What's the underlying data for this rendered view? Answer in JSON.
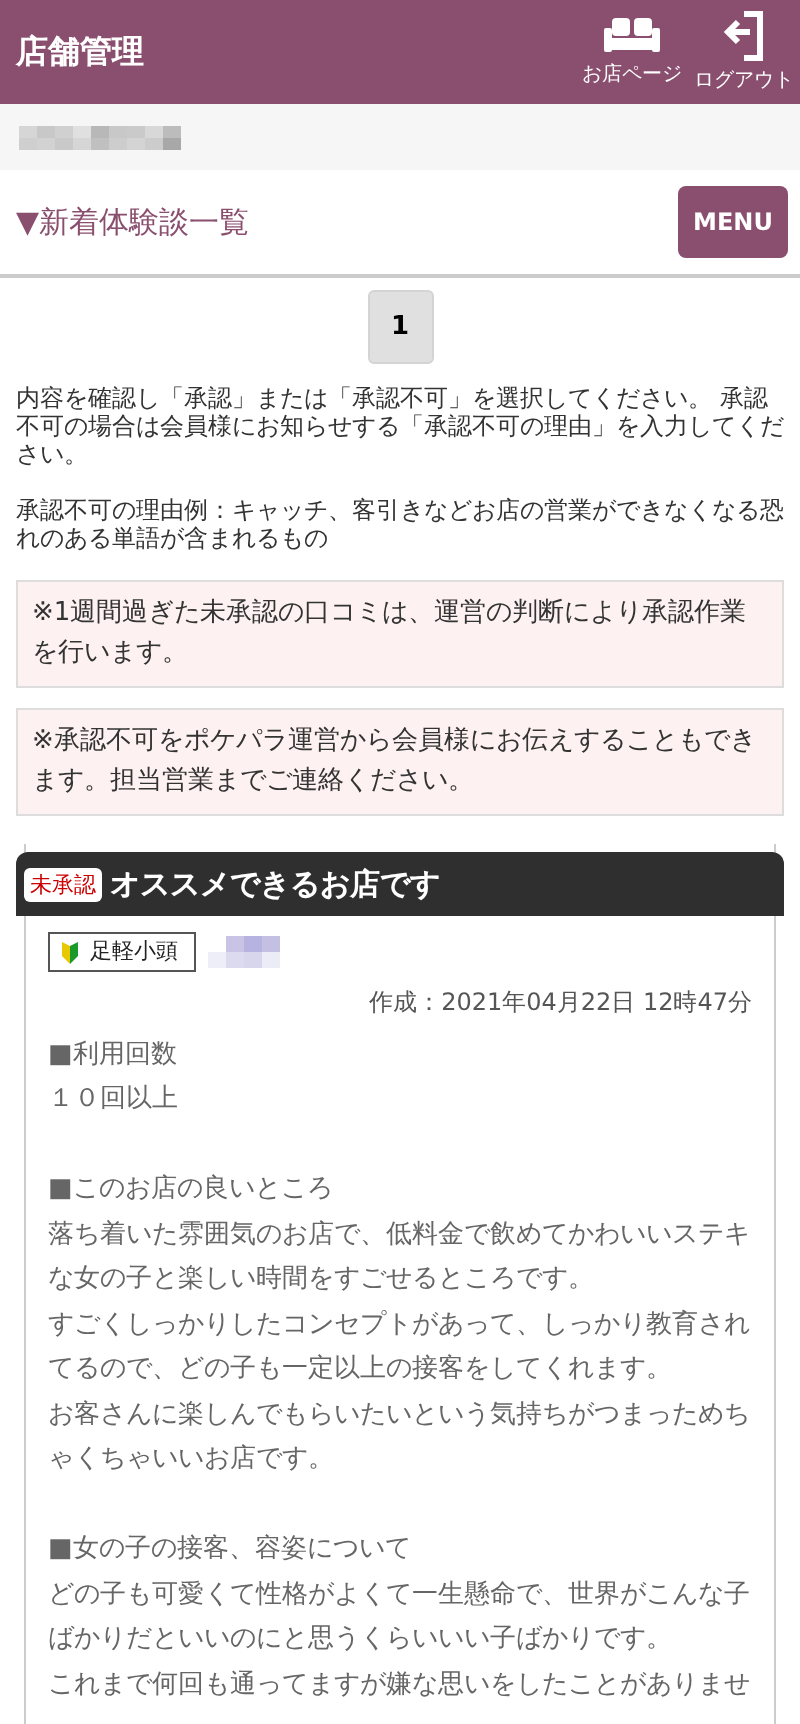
{
  "header": {
    "title": "店舗管理",
    "links": [
      {
        "kind": "shop",
        "label": "お店ページ"
      },
      {
        "kind": "logout",
        "label": "ログアウト"
      }
    ]
  },
  "section": {
    "title": "▼新着体験談一覧",
    "menu_button": "MENU"
  },
  "pagination": [
    {
      "label": "1"
    }
  ],
  "instructions": [
    "内容を確認し「承認」または「承認不可」を選択してください。 承認不可の場合は会員様にお知らせする「承認不可の理由」を入力してください。",
    "承認不可の理由例：キャッチ、客引きなどお店の営業ができなくなる恐れのある単語が含まれるもの"
  ],
  "notices": [
    "※1週間過ぎた未承認の口コミは、運営の判断により承認作業を行います。",
    "※承認不可をポケパラ運営から会員様にお伝えすることもできます。担当営業までご連絡ください。"
  ],
  "reviews": [
    {
      "status": "未承認",
      "title": "オススメできるお店です",
      "rank_badge": "足軽小頭",
      "created": "作成：2021年04月22日 12時47分",
      "sections": [
        {
          "heading": "■利用回数",
          "lines": [
            "１０回以上"
          ]
        },
        {
          "heading": "■このお店の良いところ",
          "lines": [
            "落ち着いた雰囲気のお店で、低料金で飲めてかわいいステキな女の子と楽しい時間をすごせるところです。",
            "すごくしっかりしたコンセプトがあって、しっかり教育されてるので、どの子も一定以上の接客をしてくれます。",
            "お客さんに楽しんでもらいたいという気持ちがつまっためちゃくちゃいいお店です。"
          ]
        },
        {
          "heading": "■女の子の接客、容姿について",
          "lines": [
            "どの子も可愛くて性格がよくて一生懸命で、世界がこんな子ばかりだといいのにと思うくらいいい子ばかりです。",
            "これまで何回も通ってますが嫌な思いをしたことがありませ"
          ]
        }
      ]
    }
  ]
}
